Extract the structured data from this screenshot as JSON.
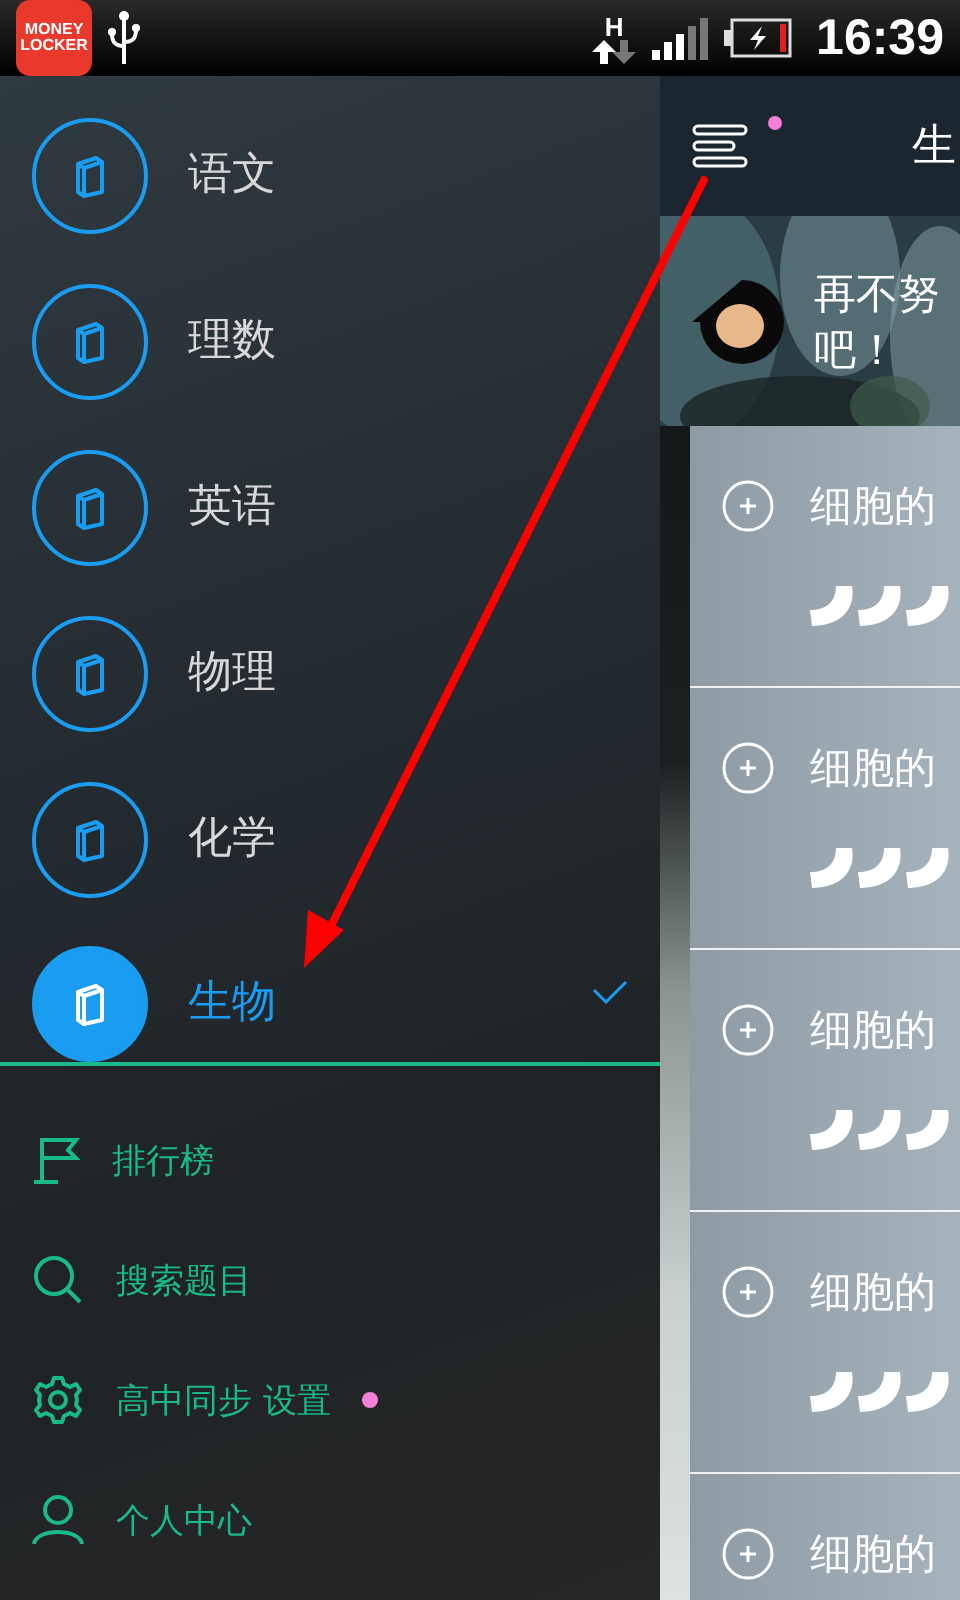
{
  "status_bar": {
    "app_icon": [
      "MONEY",
      "LOCKER"
    ],
    "network_type": "H",
    "time": "16:39"
  },
  "drawer": {
    "subjects": [
      {
        "label": "语文",
        "selected": false
      },
      {
        "label": "理数",
        "selected": false
      },
      {
        "label": "英语",
        "selected": false
      },
      {
        "label": "物理",
        "selected": false
      },
      {
        "label": "化学",
        "selected": false
      },
      {
        "label": "生物",
        "selected": true
      }
    ],
    "menu": [
      {
        "kind": "ranking",
        "label": "排行榜",
        "badge": false
      },
      {
        "kind": "search",
        "label": "搜索题目",
        "badge": false
      },
      {
        "kind": "settings",
        "label": "高中同步 设置",
        "badge": true
      },
      {
        "kind": "profile",
        "label": "个人中心",
        "badge": false
      }
    ]
  },
  "content": {
    "header": {
      "title": "生",
      "menu_badge": true
    },
    "banner": {
      "lines": [
        "再不努",
        "吧！"
      ]
    },
    "cards": [
      {
        "title": "细胞的",
        "stars": 3
      },
      {
        "title": "细胞的",
        "stars": 3
      },
      {
        "title": "细胞的",
        "stars": 3
      },
      {
        "title": "细胞的",
        "stars": 3
      },
      {
        "title": "细胞的"
      }
    ]
  }
}
